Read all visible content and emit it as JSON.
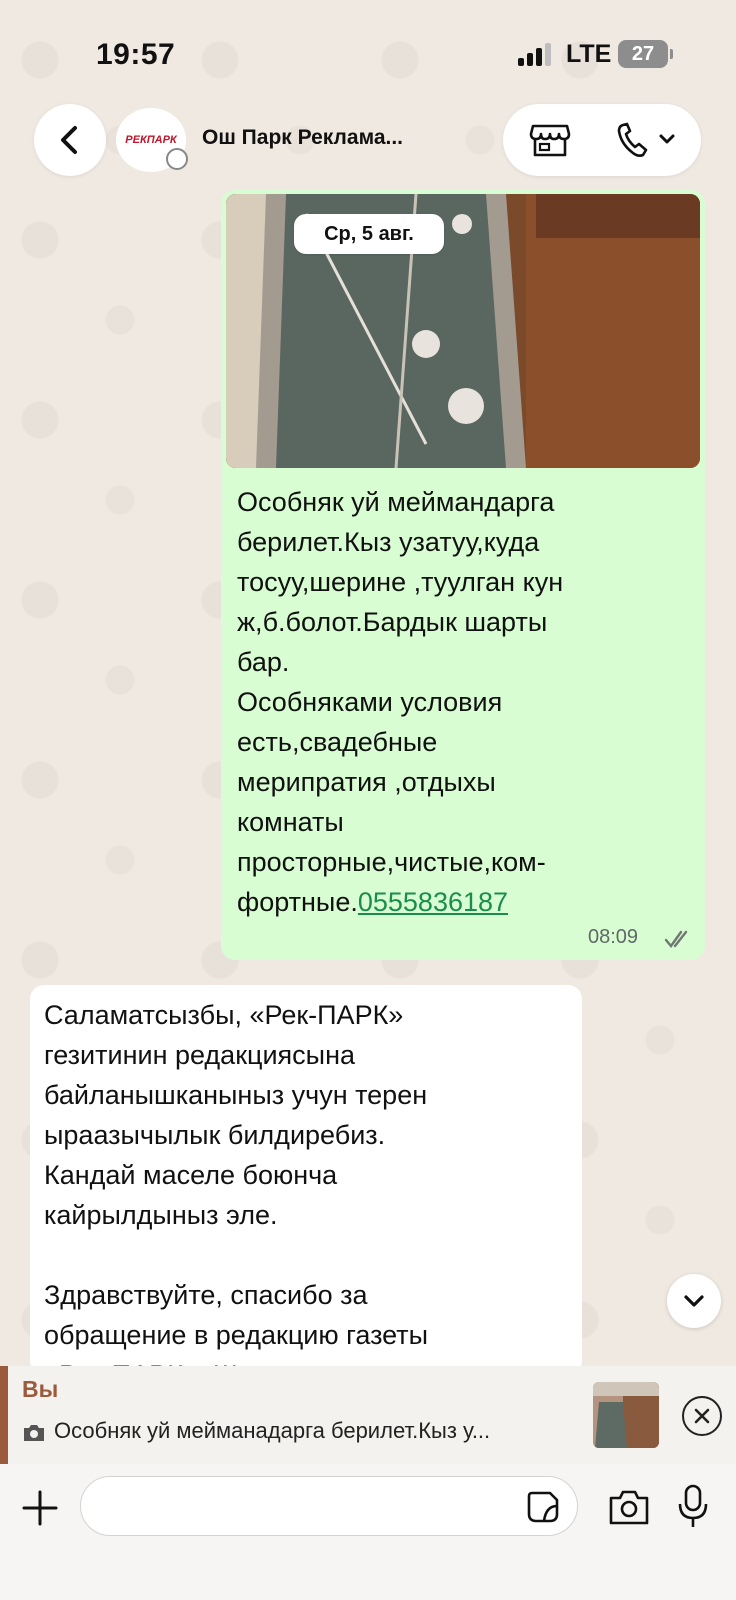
{
  "status_bar": {
    "time": "19:57",
    "network": "LTE",
    "battery": "27"
  },
  "header": {
    "avatar_text": "РЕКПАРК",
    "title": "Ош Парк Реклама..."
  },
  "date_chip": "Ср, 5 авг.",
  "outgoing_message": {
    "text_lines": [
      "Особняк уй меймандарга",
      "берилет.Кыз узатуу,куда",
      "тосуу,шерине ,туулган кун",
      "ж,б.болот.Бардык шарты",
      "бар.",
      "Особняками условия",
      "есть,свадебные",
      "мерипратия ,отдыхы",
      "комнаты",
      "просторные,чистые,ком-"
    ],
    "last_line_prefix": "фортные.",
    "phone": "0555836187",
    "time": "08:09"
  },
  "incoming_message": {
    "paragraph_ky": "Саламатсызбы, «Рек-ПАРК»\nгезитинин редакциясына\nбайланышканыныз учун терен\nыраазычылык билдиребиз.\nКандай маселе боюнча\nкайрылдыныз эле.",
    "paragraph_ru": "Здравствуйте, спасибо за\nобращение в редакцию газеты\n«Рек-ПАРК». Ш..."
  },
  "reply_preview": {
    "author": "Вы",
    "text": "Особняк уй мейманадарга берилет.Кыз у..."
  },
  "composer": {
    "value": "",
    "placeholder": ""
  },
  "colors": {
    "outgoing_bubble": "#d9fdd3",
    "incoming_bubble": "#ffffff",
    "link": "#1a8d4e",
    "reply_accent": "#9c5a3c"
  }
}
